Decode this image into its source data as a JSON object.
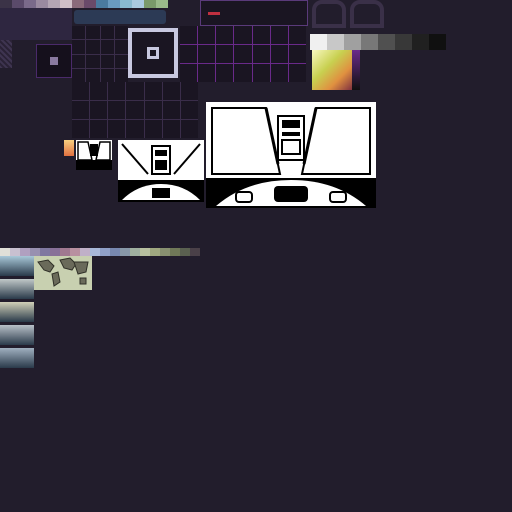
{
  "sheet": {
    "background": "#221d2c",
    "accent_purple": "#7a3aa0",
    "panel_blue": "#2c3a55",
    "selection_frame": "#c8c8e0"
  },
  "palettes": {
    "top_strip": [
      "#3b3347",
      "#5a4a6a",
      "#7a6a8a",
      "#9a8aa0",
      "#b4a6b4",
      "#d0c0c8",
      "#8a6a7a",
      "#6a4a6a",
      "#4a7aa0",
      "#6a9ac0",
      "#8abad0",
      "#aacae0",
      "#7a9a6a",
      "#9aba8a"
    ],
    "mid_strip": [
      "#e0e0d8",
      "#c8c0d0",
      "#b0a0c0",
      "#9890b0",
      "#8078a0",
      "#887098",
      "#a07890",
      "#b890a0",
      "#c0b0c8",
      "#a8b8d8",
      "#90a0c8",
      "#7888b0",
      "#8898a8",
      "#a0b0a0",
      "#b8c0a0",
      "#a0a880",
      "#889070",
      "#707858",
      "#5a6050",
      "#4a4048"
    ],
    "gradient_grays": [
      "#f0f0f0",
      "#c8c8c8",
      "#a0a0a0",
      "#787878",
      "#505050",
      "#383838",
      "#202020",
      "#101010"
    ],
    "gradient_colors": [
      "#f8f8b0",
      "#e8e070",
      "#c8d040",
      "#a0c040",
      "#80b050",
      "#e0a040",
      "#c06030",
      "#803040"
    ]
  },
  "ships": {
    "large": {
      "background": "#ffffff",
      "ink": "#000000"
    },
    "small": {
      "background": "#ffffff",
      "ink": "#000000"
    }
  },
  "thumbnails": {
    "map_tint": "#c8d0b0",
    "scene_tints": [
      "#a8c8d8",
      "#c0c8c8",
      "#d0d0b8",
      "#b8c0c8",
      "#a0b0c0"
    ]
  }
}
